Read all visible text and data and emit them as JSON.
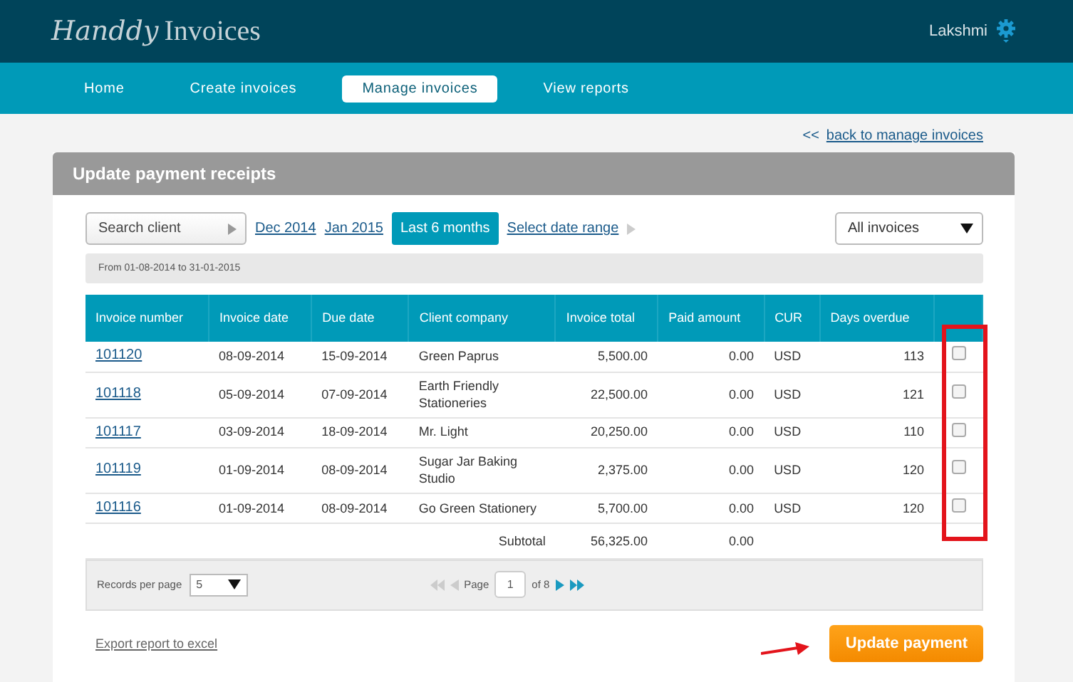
{
  "brand": {
    "script": "Handdy",
    "word": "Invoices"
  },
  "user": {
    "name": "Lakshmi"
  },
  "nav": [
    {
      "label": "Home",
      "selected": false
    },
    {
      "label": "Create invoices",
      "selected": false
    },
    {
      "label": "Manage invoices",
      "selected": true
    },
    {
      "label": "View reports",
      "selected": false
    }
  ],
  "back_link": {
    "arrows": "<<",
    "label": "back to manage invoices"
  },
  "panel": {
    "title": "Update payment receipts"
  },
  "filters": {
    "search": {
      "placeholder": "Search client"
    },
    "periods": [
      {
        "label": "Dec 2014",
        "selected": false
      },
      {
        "label": "Jan 2015",
        "selected": false
      },
      {
        "label": "Last 6 months",
        "selected": true
      },
      {
        "label": "Select date range",
        "selected": false
      }
    ],
    "type_select": "All invoices"
  },
  "range_note": "From 01-08-2014 to 31-01-2015",
  "table": {
    "columns": [
      "Invoice number",
      "Invoice date",
      "Due date",
      "Client company",
      "Invoice total",
      "Paid amount",
      "CUR",
      "Days overdue"
    ],
    "rows": [
      {
        "number": "101120",
        "date": "08-09-2014",
        "due": "15-09-2014",
        "client": "Green Paprus",
        "total": "5,500.00",
        "paid": "0.00",
        "cur": "USD",
        "days": "113",
        "checked": false
      },
      {
        "number": "101118",
        "date": "05-09-2014",
        "due": "07-09-2014",
        "client": "Earth Friendly Stationeries",
        "total": "22,500.00",
        "paid": "0.00",
        "cur": "USD",
        "days": "121",
        "checked": false
      },
      {
        "number": "101117",
        "date": "03-09-2014",
        "due": "18-09-2014",
        "client": "Mr. Light",
        "total": "20,250.00",
        "paid": "0.00",
        "cur": "USD",
        "days": "110",
        "checked": false
      },
      {
        "number": "101119",
        "date": "01-09-2014",
        "due": "08-09-2014",
        "client": "Sugar Jar Baking Studio",
        "total": "2,375.00",
        "paid": "0.00",
        "cur": "USD",
        "days": "120",
        "checked": false
      },
      {
        "number": "101116",
        "date": "01-09-2014",
        "due": "08-09-2014",
        "client": "Go Green Stationery",
        "total": "5,700.00",
        "paid": "0.00",
        "cur": "USD",
        "days": "120",
        "checked": false
      }
    ],
    "subtotal": {
      "label": "Subtotal",
      "total": "56,325.00",
      "paid": "0.00"
    }
  },
  "pager": {
    "records_label": "Records per page",
    "records_value": "5",
    "page_label": "Page",
    "page_value": "1",
    "of_label": "of 8"
  },
  "export_link": "Export report to excel",
  "update_button": "Update payment"
}
